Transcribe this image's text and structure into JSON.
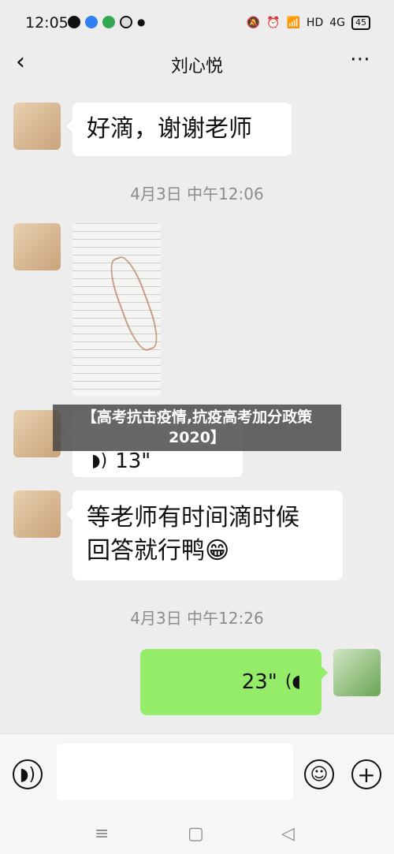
{
  "status": {
    "time": "12:05",
    "network": "HD",
    "signal": "4G",
    "battery": "45"
  },
  "header": {
    "back_label": "‹",
    "title": "刘心悦",
    "more_label": "⋯"
  },
  "messages": {
    "m1": "好滴，谢谢老师",
    "t1": "4月3日 中午12:06",
    "voice1": "13\"",
    "m2_line1": "等老师有时间滴时候",
    "m2_line2": "回答就行鸭",
    "m2_emoji": "😁",
    "t2": "4月3日 中午12:26",
    "voice2": "23\""
  },
  "banner": {
    "text": "【高考抗击疫情,抗疫高考加分政策2020】"
  },
  "colors": {
    "bubble_green": "#95ec69",
    "bubble_white": "#ffffff",
    "background": "#ededed"
  },
  "inputbar": {
    "voice_icon": "voice-mode-icon",
    "emoji_icon": "emoji-icon",
    "plus_icon": "plus-icon"
  },
  "nav": {
    "menu": "≡",
    "home": "▢",
    "back": "◁"
  }
}
